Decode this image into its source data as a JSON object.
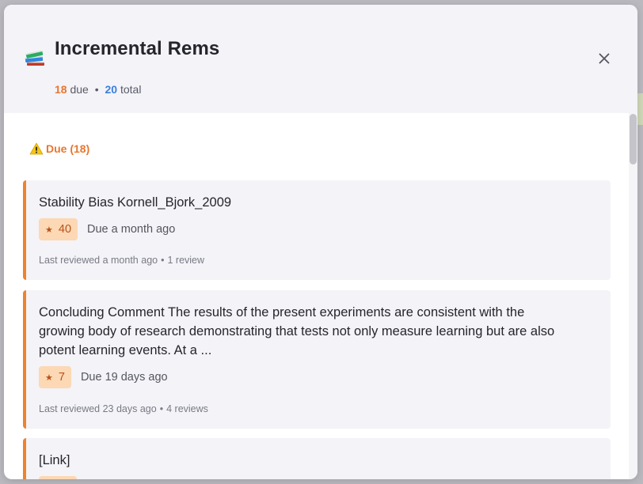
{
  "header": {
    "title": "Incremental Rems",
    "due_count": "18",
    "due_label": "due",
    "separator": "•",
    "total_count": "20",
    "total_label": "total"
  },
  "section": {
    "label": "Due (18)",
    "icon": "warning-icon"
  },
  "cards": [
    {
      "title": "Stability Bias Kornell_Bjork_2009",
      "priority": "40",
      "due": "Due a month ago",
      "last_reviewed": "Last reviewed a month ago",
      "reviews": "1 review"
    },
    {
      "title": "Concluding Comment The results of the present experiments are consistent with the growing body of research demonstrating that tests not only measure learning but are also potent learning events. At a ...",
      "priority": "7",
      "due": "Due 19 days ago",
      "last_reviewed": "Last reviewed 23 days ago",
      "reviews": "4 reviews"
    },
    {
      "title": "[Link]"
    }
  ],
  "colors": {
    "accent_orange": "#f0822a",
    "due_orange": "#e8772e",
    "total_blue": "#3b7fe0",
    "priority_bg": "#fcd8b4"
  }
}
